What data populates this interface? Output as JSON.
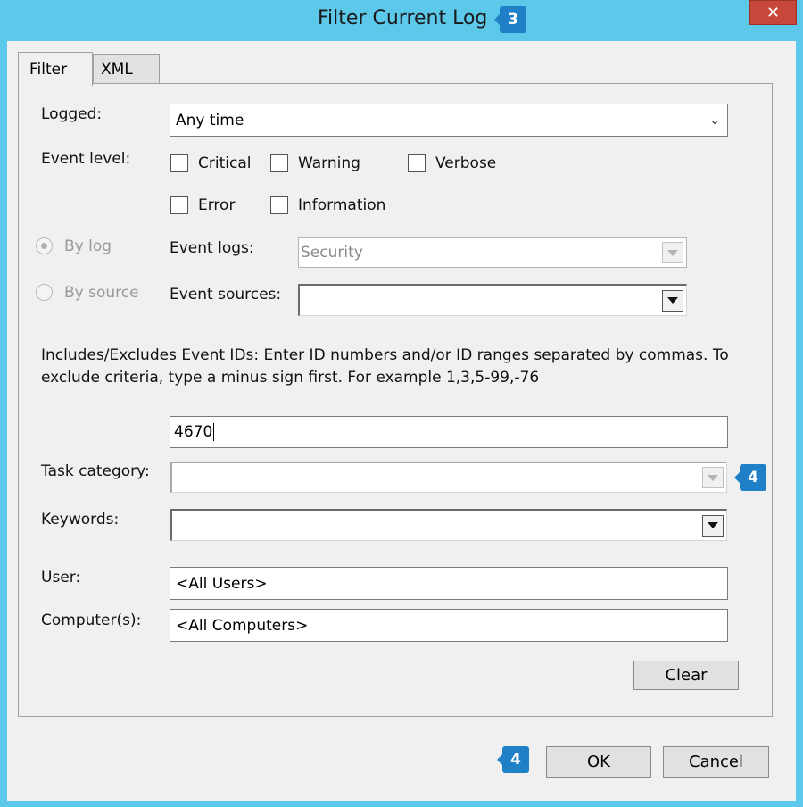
{
  "window": {
    "title": "Filter Current Log",
    "close_glyph": "✕"
  },
  "annotations": {
    "title_badge": "3",
    "task_badge": "4",
    "ok_badge": "4",
    "badge_color": "#1f7fc7"
  },
  "tabs": [
    {
      "label": "Filter",
      "active": true
    },
    {
      "label": "XML",
      "active": false
    }
  ],
  "filter": {
    "logged": {
      "label": "Logged:",
      "value": "Any time"
    },
    "event_level": {
      "label": "Event level:",
      "critical": "Critical",
      "warning": "Warning",
      "verbose": "Verbose",
      "error": "Error",
      "information": "Information"
    },
    "by_log": "By log",
    "by_source": "By source",
    "event_logs": {
      "label": "Event logs:",
      "value": "Security"
    },
    "event_sources": {
      "label": "Event sources:",
      "value": ""
    },
    "description": "Includes/Excludes Event IDs: Enter ID numbers and/or ID ranges separated by commas. To exclude criteria, type a minus sign first. For example 1,3,5-99,-76",
    "event_ids": "4670",
    "task_category": {
      "label": "Task category:",
      "value": ""
    },
    "keywords": {
      "label": "Keywords:",
      "value": ""
    },
    "user": {
      "label": "User:",
      "value": "<All Users>"
    },
    "computers": {
      "label": "Computer(s):",
      "value": "<All Computers>"
    },
    "clear": "Clear"
  },
  "footer": {
    "ok": "OK",
    "cancel": "Cancel"
  }
}
